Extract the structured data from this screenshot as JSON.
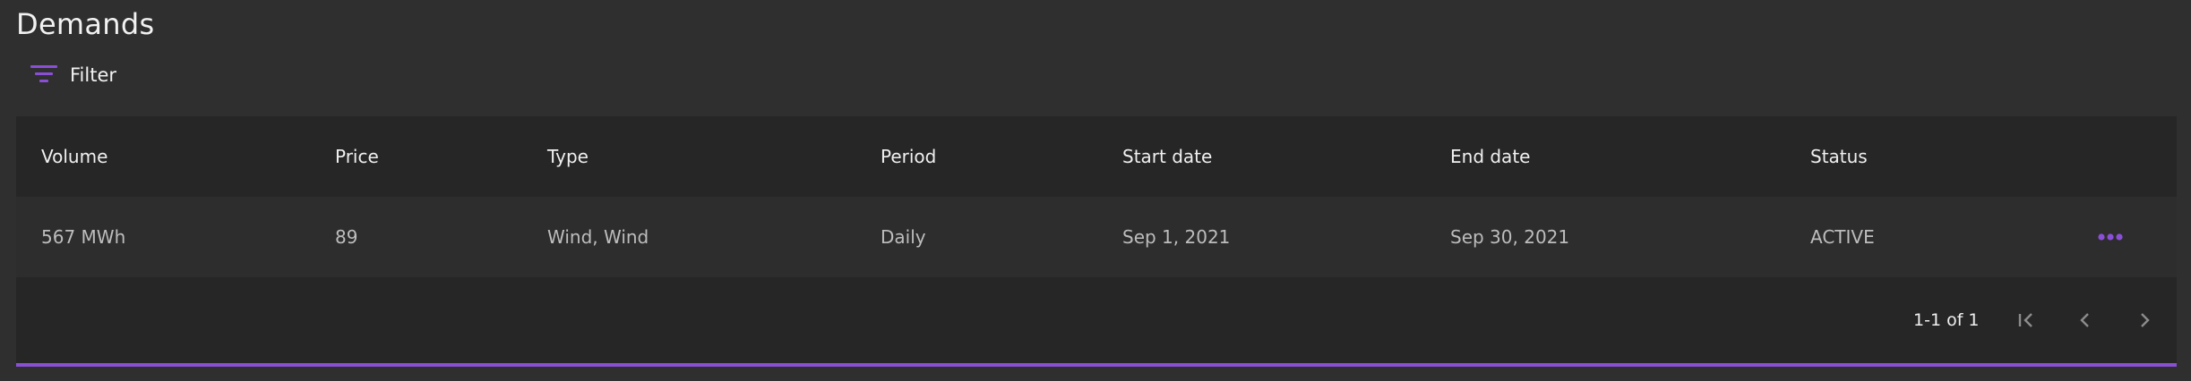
{
  "page": {
    "title": "Demands"
  },
  "filter": {
    "label": "Filter",
    "icon": "filter-icon"
  },
  "table": {
    "columns": [
      "Volume",
      "Price",
      "Type",
      "Period",
      "Start date",
      "End date",
      "Status"
    ],
    "rows": [
      {
        "volume": "567 MWh",
        "price": "89",
        "type": "Wind, Wind",
        "period": "Daily",
        "start_date": "Sep 1, 2021",
        "end_date": "Sep 30, 2021",
        "status": "ACTIVE",
        "action_icon": "more-horizontal-icon"
      }
    ]
  },
  "pagination": {
    "range": "1-1 of 1",
    "icons": [
      "first-page-icon",
      "chevron-left-icon",
      "chevron-right-icon"
    ]
  },
  "colors": {
    "background": "#2f2f2f",
    "table": "#262626",
    "row": "#2d2d2d",
    "accent": "#8a4fd6"
  }
}
